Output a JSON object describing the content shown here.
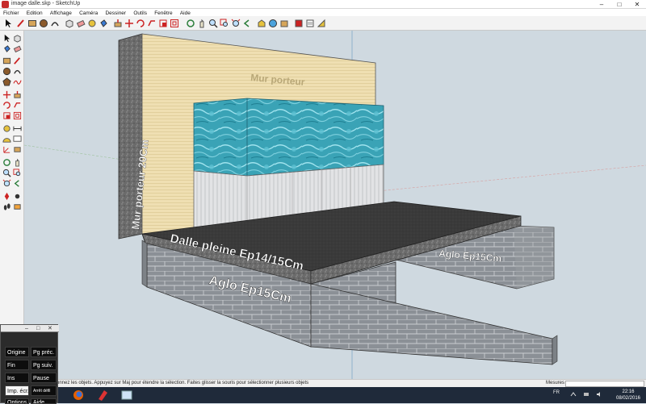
{
  "window": {
    "title": "image dalle.skp - SketchUp",
    "minimize": "–",
    "maximize": "□",
    "close": "✕"
  },
  "menu": [
    "Fichier",
    "Edition",
    "Affichage",
    "Caméra",
    "Dessiner",
    "Outils",
    "Fenêtre",
    "Aide"
  ],
  "scene": {
    "labels": {
      "mur_porteur": "Mur porteur",
      "mur_porteur_20": "Mur porteur 20Cm",
      "dalle": "Dalle pleine Ep14/15Cm",
      "aglo_front": "Aglo Ep15Cm",
      "aglo_right": "Aglo Ep15Cm"
    }
  },
  "status": {
    "hint": "onnez les objets. Appuyez sur Maj pour étendre la sélection. Faites glisser la souris pour sélectionner plusieurs objets",
    "measures_label": "Mesures",
    "measures_value": ""
  },
  "onscreen_keyboard": {
    "keys": [
      "Origine",
      "Pg préc.",
      "Fin",
      "Pg suiv.",
      "Ins",
      "Pause",
      "Imp. écr.",
      "Arrêt défil",
      "Options",
      "Aide"
    ]
  },
  "taskbar": {
    "language": "FR",
    "time": "22:16",
    "date": "08/02/2016"
  },
  "colors": {
    "viewport_bg": "#cfd9e0",
    "wall_wood": "#efdfb2",
    "pool_water": "#3aa3b6",
    "slab": "#3b3b3b",
    "blocks": "#8a8f94",
    "label_text": "#ffffff"
  }
}
